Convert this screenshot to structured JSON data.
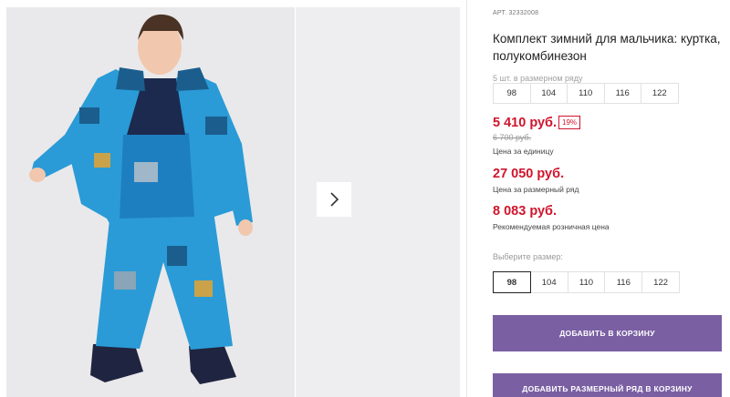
{
  "gallery": {
    "next_icon": "chevron-right-icon",
    "photo_colors": {
      "jacket": "#2a9bd6",
      "jacket_dark": "#1b5e8e",
      "bib": "#1e7fc0",
      "navy": "#1b2a4e",
      "boots": "#1f2440",
      "skin": "#f1c7ae",
      "hair": "#4a3324"
    }
  },
  "product": {
    "art_label": "АРТ.",
    "art_value": "32332008",
    "title": "Комплект зимний для мальчика: куртка, полукомбинезон",
    "series_caption": "5 шт. в размерном ряду",
    "series_sizes": [
      "98",
      "104",
      "110",
      "116",
      "122"
    ],
    "price": "5 410 руб.",
    "discount": "19%",
    "old_price": "6 700 руб.",
    "unit_caption": "Цена за единицу",
    "series_price": "27 050 руб.",
    "series_price_caption": "Цена за размерный ряд",
    "retail_price": "8 083 руб.",
    "retail_caption": "Рекомендуемая розничная цена",
    "choose_label": "Выберите размер:",
    "choose_sizes": [
      "98",
      "104",
      "110",
      "116",
      "122"
    ],
    "selected_size": "98",
    "add_to_cart": "ДОБАВИТЬ В КОРЗИНУ",
    "add_series": "ДОБАВИТЬ РАЗМЕРНЫЙ РЯД В КОРЗИНУ"
  },
  "colors": {
    "accent": "#7a5fa3",
    "price": "#d0142c"
  }
}
